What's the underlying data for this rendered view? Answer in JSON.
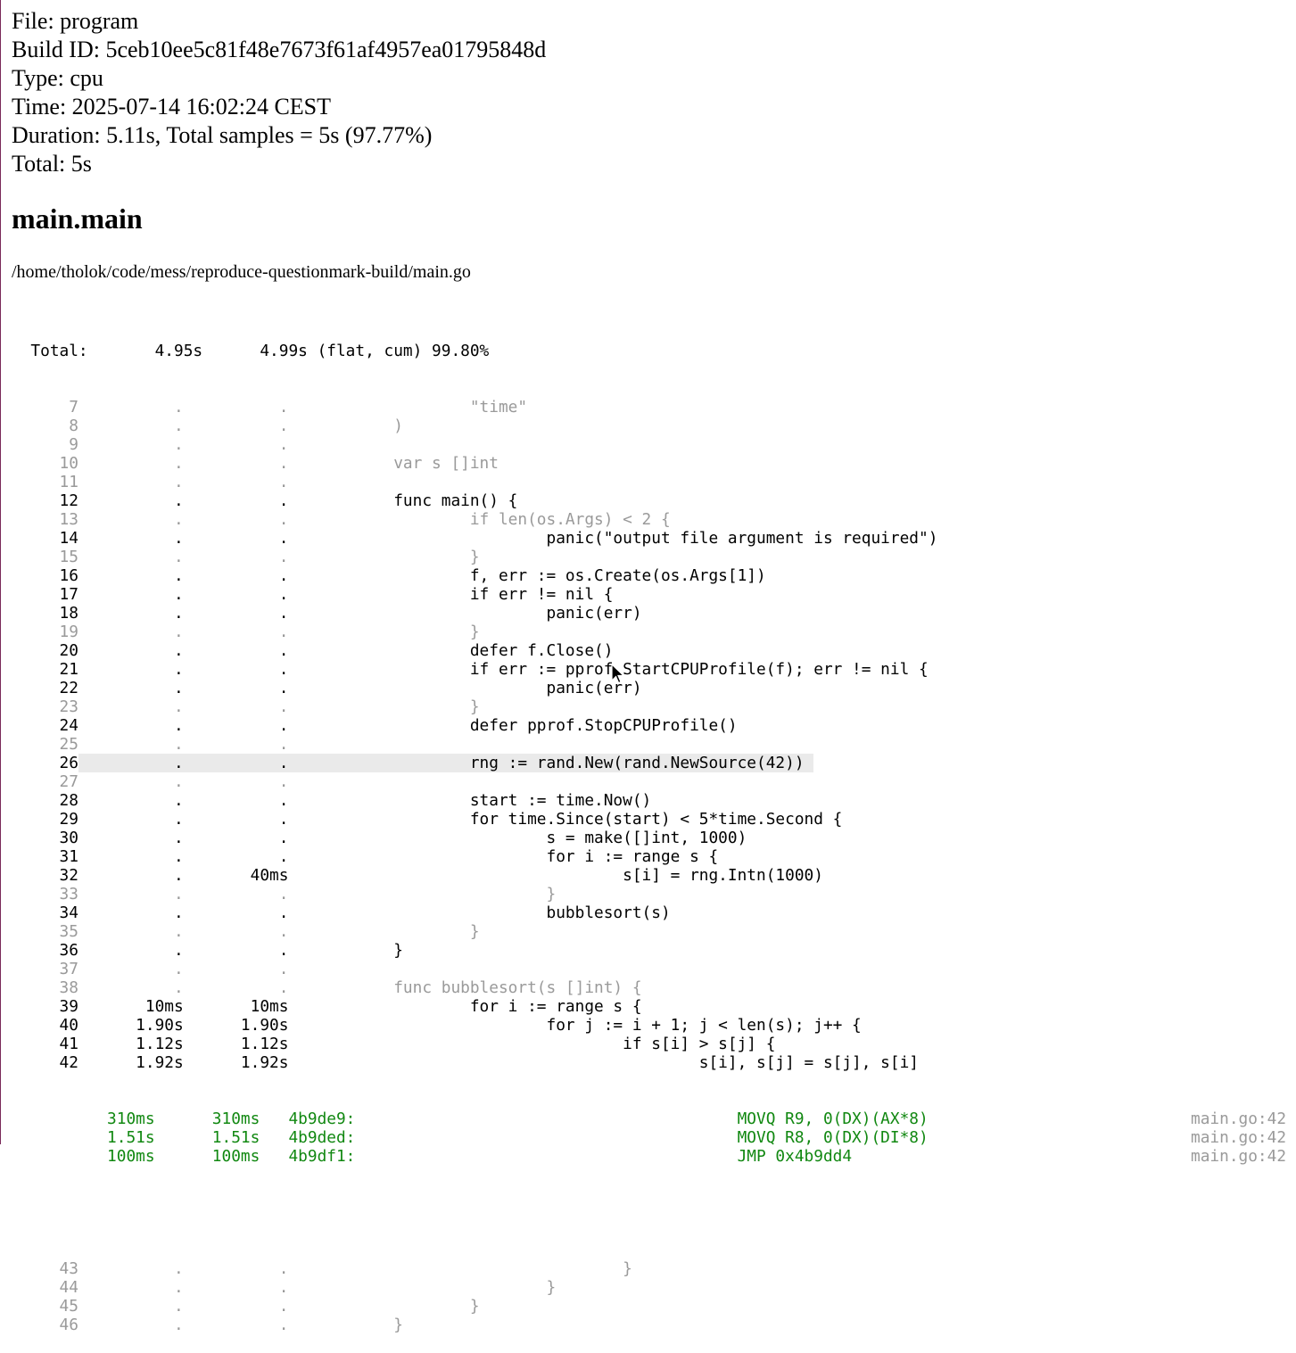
{
  "header": {
    "file": "File: program",
    "build_id": "Build ID: 5ceb10ee5c81f48e7673f61af4957ea01795848d",
    "type": "Type: cpu",
    "time": "Time: 2025-07-14 16:02:24 CEST",
    "duration": "Duration: 5.11s, Total samples = 5s (97.77%)",
    "total": "Total: 5s"
  },
  "function_name": "main.main",
  "file_path": "/home/tholok/code/mess/reproduce-questionmark-build/main.go",
  "listing": {
    "total_line": "  Total:       4.95s      4.99s (flat, cum) 99.80%",
    "lines": [
      {
        "text": "      7          .          .                   \"time\"",
        "dim": true
      },
      {
        "text": "      8          .          .           )",
        "dim": true
      },
      {
        "text": "      9          .          .",
        "dim": true
      },
      {
        "text": "     10          .          .           var s []int",
        "dim": true
      },
      {
        "text": "     11          .          .",
        "dim": true
      },
      {
        "text": "     12          .          .           func main() {",
        "dim": false
      },
      {
        "text": "     13          .          .                   if len(os.Args) < 2 {",
        "dim": true
      },
      {
        "text": "     14          .          .                           panic(\"output file argument is required\")",
        "dim": false
      },
      {
        "text": "     15          .          .                   }",
        "dim": true
      },
      {
        "text": "     16          .          .                   f, err := os.Create(os.Args[1])",
        "dim": false
      },
      {
        "text": "     17          .          .                   if err != nil {",
        "dim": false
      },
      {
        "text": "     18          .          .                           panic(err)",
        "dim": false
      },
      {
        "text": "     19          .          .                   }",
        "dim": true
      },
      {
        "text": "     20          .          .                   defer f.Close()",
        "dim": false
      },
      {
        "text": "     21          .          .                   if err := pprof.StartCPUProfile(f); err != nil {",
        "dim": false
      },
      {
        "text": "     22          .          .                           panic(err)",
        "dim": false
      },
      {
        "text": "     23          .          .                   }",
        "dim": true
      },
      {
        "text": "     24          .          .                   defer pprof.StopCPUProfile()",
        "dim": false
      },
      {
        "text": "     25          .          .",
        "dim": true
      },
      {
        "text": "     26          .          .                   rng := rand.New(rand.NewSource(42)) ",
        "dim": false,
        "highlight": true
      },
      {
        "text": "     27          .          .",
        "dim": true
      },
      {
        "text": "     28          .          .                   start := time.Now()",
        "dim": false
      },
      {
        "text": "     29          .          .                   for time.Since(start) < 5*time.Second {",
        "dim": false
      },
      {
        "text": "     30          .          .                           s = make([]int, 1000)",
        "dim": false
      },
      {
        "text": "     31          .          .                           for i := range s {",
        "dim": false
      },
      {
        "text": "     32          .       40ms                                   s[i] = rng.Intn(1000)",
        "dim": false
      },
      {
        "text": "     33          .          .                           }",
        "dim": true
      },
      {
        "text": "     34          .          .                           bubblesort(s)",
        "dim": false
      },
      {
        "text": "     35          .          .                   }",
        "dim": true
      },
      {
        "text": "     36          .          .           }",
        "dim": false
      },
      {
        "text": "     37          .          .",
        "dim": true
      },
      {
        "text": "     38          .          .           func bubblesort(s []int) {",
        "dim": true
      },
      {
        "text": "     39       10ms       10ms                   for i := range s {",
        "dim": false
      },
      {
        "text": "     40      1.90s      1.90s                           for j := i + 1; j < len(s); j++ {",
        "dim": false
      },
      {
        "text": "     41      1.12s      1.12s                                   if s[i] > s[j] {",
        "dim": false
      },
      {
        "text": "     42      1.92s      1.92s                                           s[i], s[j] = s[j], s[i]",
        "dim": false
      }
    ],
    "asm_lines": [
      {
        "text": "          310ms      310ms   4b9de9:                                        MOVQ R9, 0(DX)(AX*8)",
        "loc": "main.go:42"
      },
      {
        "text": "          1.51s      1.51s   4b9ded:                                        MOVQ R8, 0(DX)(DI*8)",
        "loc": "main.go:42"
      },
      {
        "text": "          100ms      100ms   4b9df1:                                        JMP 0x4b9dd4",
        "loc": "main.go:42"
      }
    ],
    "tail_lines": [
      {
        "text": "     43          .          .                                   }",
        "dim": true
      },
      {
        "text": "     44          .          .                           }",
        "dim": true
      },
      {
        "text": "     45          .          .                   }",
        "dim": true
      },
      {
        "text": "     46          .          .           }",
        "dim": true
      }
    ]
  }
}
